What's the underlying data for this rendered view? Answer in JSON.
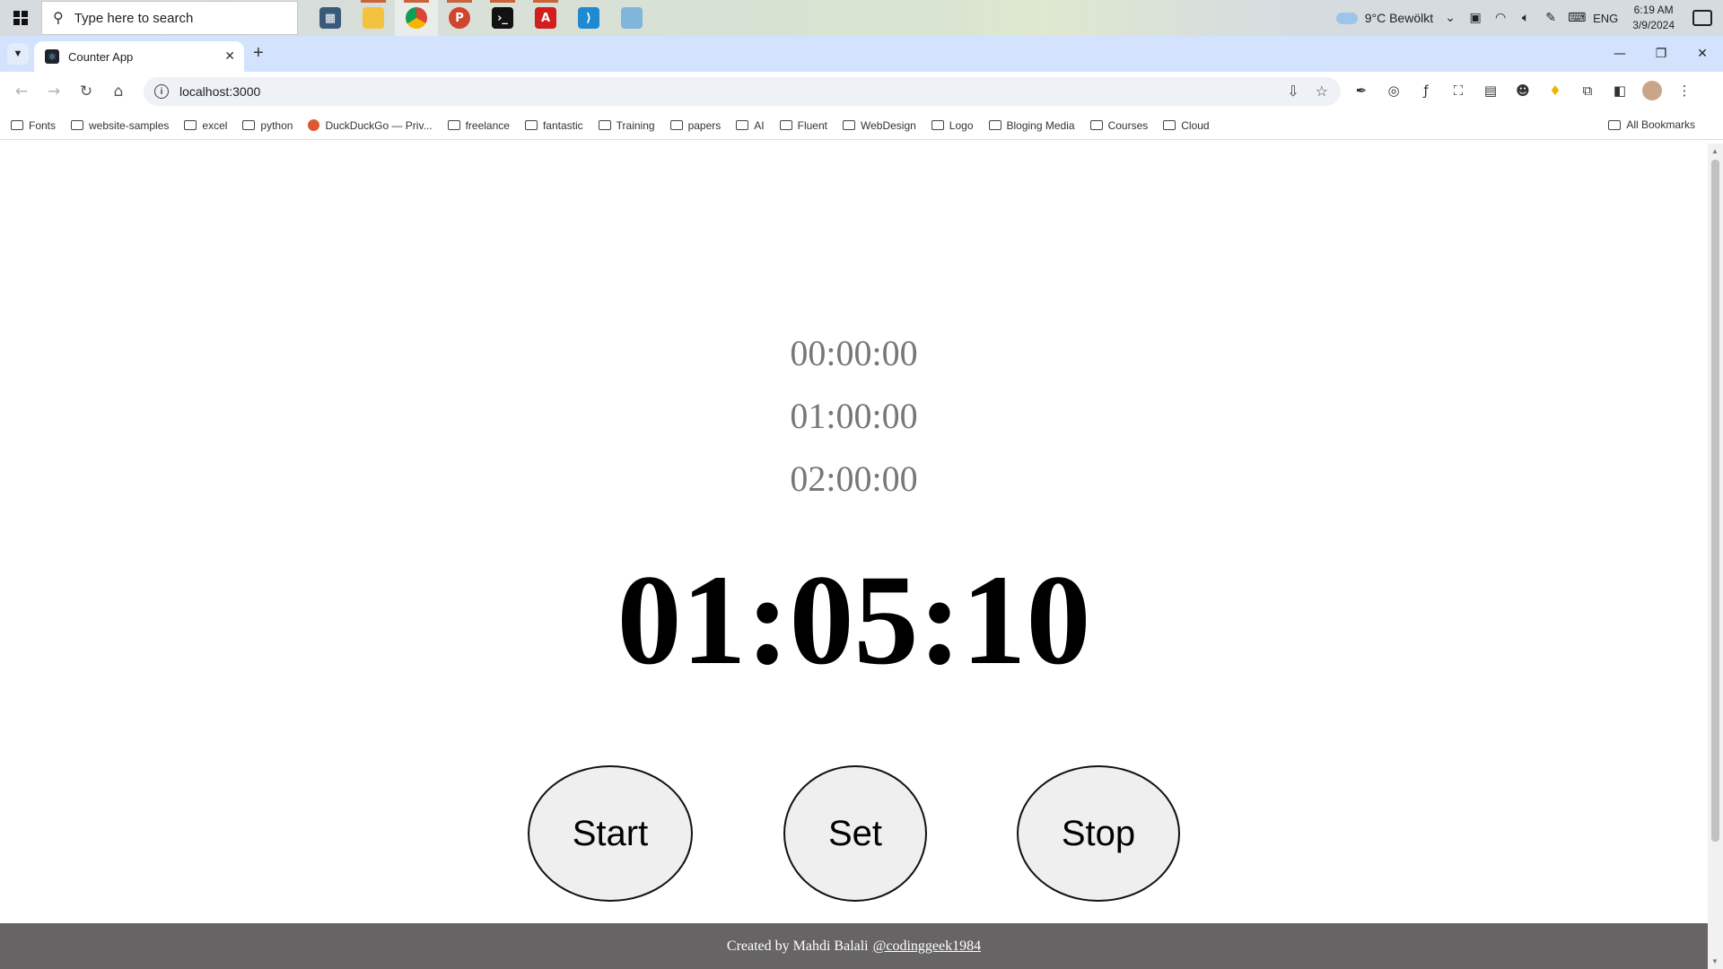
{
  "taskbar": {
    "search_placeholder": "Type here to search",
    "apps": [
      "calculator-icon",
      "file-explorer-icon",
      "chrome-icon",
      "postman-icon",
      "terminal-icon",
      "acrobat-icon",
      "vscode-icon",
      "app-icon"
    ],
    "weather": "9°C  Bewölkt",
    "language": "ENG",
    "time": "6:19 AM",
    "date": "3/9/2024"
  },
  "browser": {
    "tab_title": "Counter App",
    "url": "localhost:3000",
    "bookmarks": [
      "Fonts",
      "website-samples",
      "excel",
      "python",
      "DuckDuckGo — Priv...",
      "freelance",
      "fantastic",
      "Training",
      "papers",
      "AI",
      "Fluent",
      "WebDesign",
      "Logo",
      "Bloging Media",
      "Courses",
      "Cloud"
    ],
    "all_bookmarks": "All Bookmarks"
  },
  "app": {
    "saved_times": [
      "00:00:00",
      "01:00:00",
      "02:00:00"
    ],
    "counter": "01:05:10",
    "buttons": {
      "start": "Start",
      "set": "Set",
      "stop": "Stop"
    },
    "footer": {
      "text": "Created by Mahdi Balali",
      "handle": "@codinggeek1984"
    }
  },
  "colors": {
    "page_bg": "#ffffff",
    "saved_time": "#777777",
    "button_bg": "#efefef",
    "footer_bg": "#666464",
    "tabstrip_bg": "#d3e3fd"
  }
}
